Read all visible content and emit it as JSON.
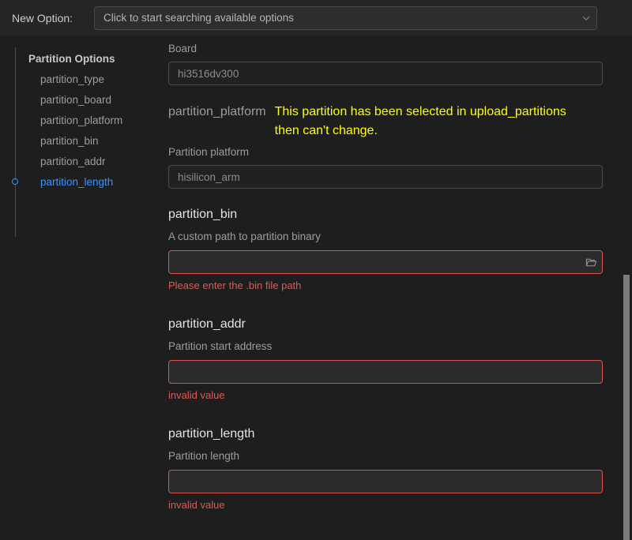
{
  "topbar": {
    "label": "New Option:",
    "combo_placeholder": "Click to start searching available options",
    "chevron_icon": "chevron-down-icon"
  },
  "sidebar": {
    "heading": "Partition Options",
    "items": [
      {
        "label": "partition_type",
        "active": false
      },
      {
        "label": "partition_board",
        "active": false
      },
      {
        "label": "partition_platform",
        "active": false
      },
      {
        "label": "partition_bin",
        "active": false
      },
      {
        "label": "partition_addr",
        "active": false
      },
      {
        "label": "partition_length",
        "active": true
      }
    ]
  },
  "fields": [
    {
      "heading": "",
      "warning": "",
      "desc": "Board",
      "value": "hi3516dv300",
      "state": "disabled",
      "folder_icon": false,
      "error": ""
    },
    {
      "heading": "partition_platform",
      "heading_muted": true,
      "warning": "This partition has been selected in upload_partitions then can't change.",
      "desc": "Partition platform",
      "value": "hisilicon_arm",
      "state": "disabled",
      "folder_icon": false,
      "error": ""
    },
    {
      "heading": "partition_bin",
      "heading_muted": false,
      "warning": "",
      "desc": "A custom path to partition binary",
      "value": "",
      "state": "error",
      "folder_icon": true,
      "error": "Please enter the .bin file path"
    },
    {
      "heading": "partition_addr",
      "heading_muted": false,
      "warning": "",
      "desc": "Partition start address",
      "value": "",
      "state": "error",
      "folder_icon": false,
      "error": "invalid value"
    },
    {
      "heading": "partition_length",
      "heading_muted": false,
      "warning": "",
      "desc": "Partition length",
      "value": "",
      "state": "error",
      "folder_icon": false,
      "error": "invalid value"
    }
  ],
  "scrollbar": {
    "name": "vertical-scrollbar"
  },
  "colors": {
    "background": "#1e1e1e",
    "topbar_background": "#252526",
    "accent_blue": "#3794ff",
    "warning_yellow": "#ffff00",
    "error_red": "#d9544d",
    "error_text": "#e05a52",
    "text_primary": "#e4e4e4",
    "text_muted": "#9d9d9d"
  }
}
